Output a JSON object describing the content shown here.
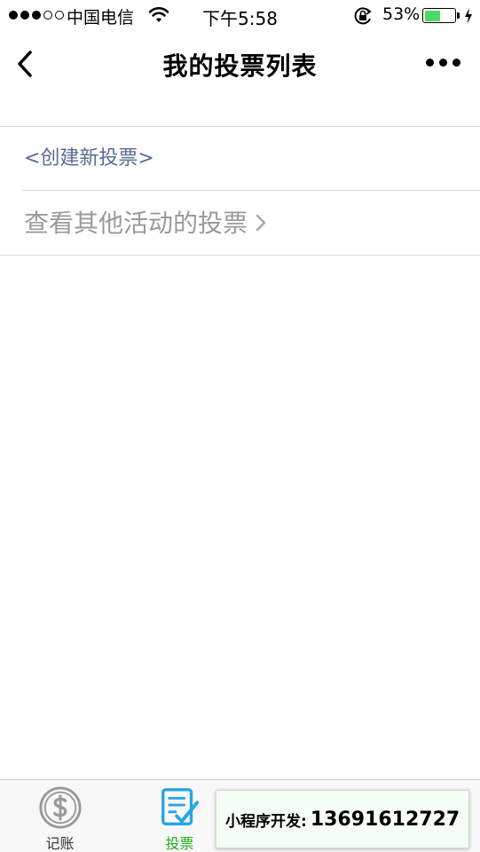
{
  "status_bar": {
    "carrier": "中国电信",
    "time": "下午5:58",
    "battery_percent": "53%",
    "battery_level": 0.53,
    "signal_bars_filled": 3,
    "signal_bars_total": 5
  },
  "nav": {
    "title": "我的投票列表"
  },
  "list": {
    "create_new": "<创建新投票>",
    "view_others": "查看其他活动的投票"
  },
  "tabbar": {
    "tabs": [
      {
        "label": "记账",
        "icon": "dollar-coin-icon",
        "active": false
      },
      {
        "label": "投票",
        "icon": "checklist-edit-icon",
        "active": true
      },
      {
        "label": "",
        "icon": "tab-icon-3",
        "active": false
      },
      {
        "label": "",
        "icon": "tab-icon-4",
        "active": false
      }
    ]
  },
  "banner": {
    "label": "小程序开发:",
    "phone": "13691612727"
  },
  "colors": {
    "link_blue": "#576b95",
    "active_green": "#1aad19",
    "battery_green": "#4cd964",
    "gray_text": "#9a9a9a",
    "icon_blue": "#2aa3e6"
  }
}
